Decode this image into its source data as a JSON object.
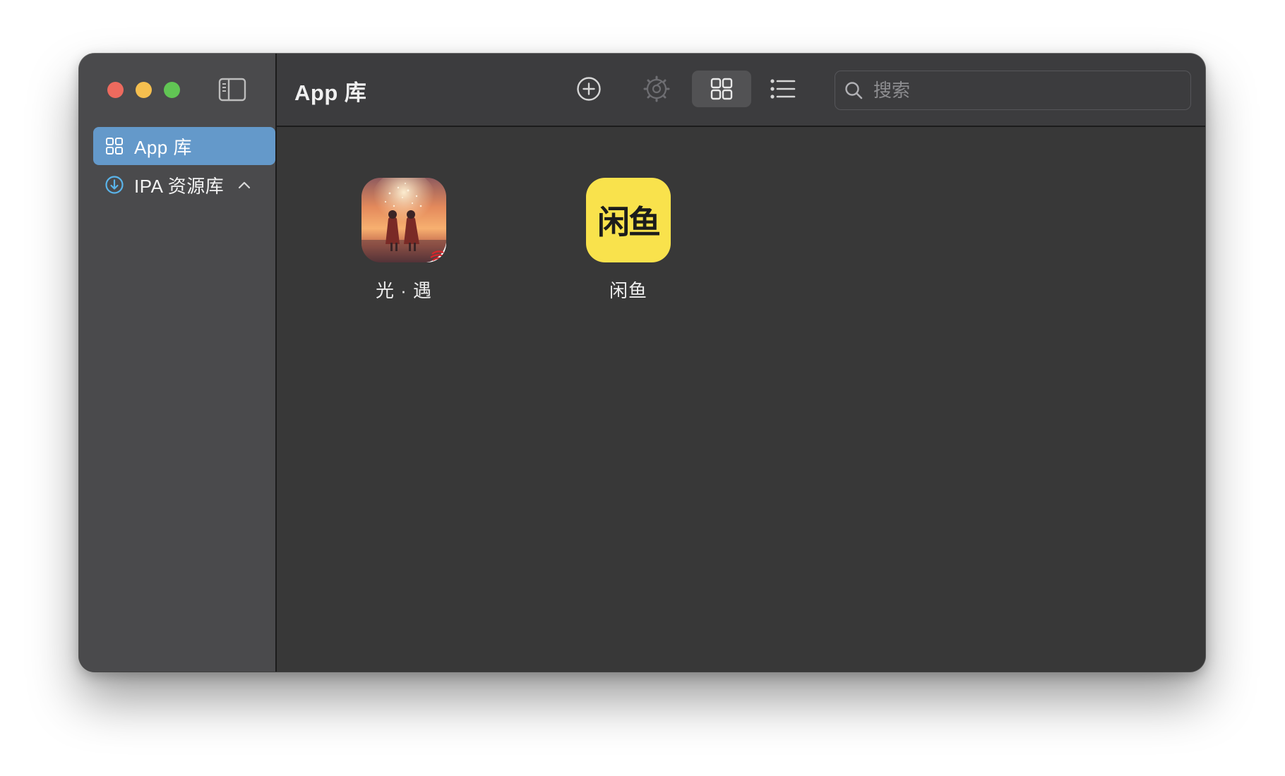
{
  "window": {
    "title": "App 库"
  },
  "sidebar": {
    "items": [
      {
        "label": "App 库",
        "icon": "grid-icon",
        "selected": true
      },
      {
        "label": "IPA 资源库",
        "icon": "download-circle-icon",
        "expanded": true
      }
    ]
  },
  "toolbar": {
    "buttons": [
      {
        "name": "add",
        "icon": "plus-circle-icon"
      },
      {
        "name": "settings",
        "icon": "gear-icon"
      },
      {
        "name": "grid-view",
        "icon": "grid-view-icon",
        "active": true
      },
      {
        "name": "list-view",
        "icon": "list-view-icon"
      }
    ]
  },
  "search": {
    "placeholder": "搜索",
    "value": ""
  },
  "apps": [
    {
      "name": "光 · 遇",
      "icon": "sky-app-icon"
    },
    {
      "name": "闲鱼",
      "icon": "xianyu-app-icon",
      "icon_text": "闲鱼"
    }
  ],
  "colors": {
    "accent": "#6499ca",
    "sidebar_bg": "#4a4a4c",
    "content_bg": "#383838",
    "xianyu_yellow": "#f9e24c"
  }
}
